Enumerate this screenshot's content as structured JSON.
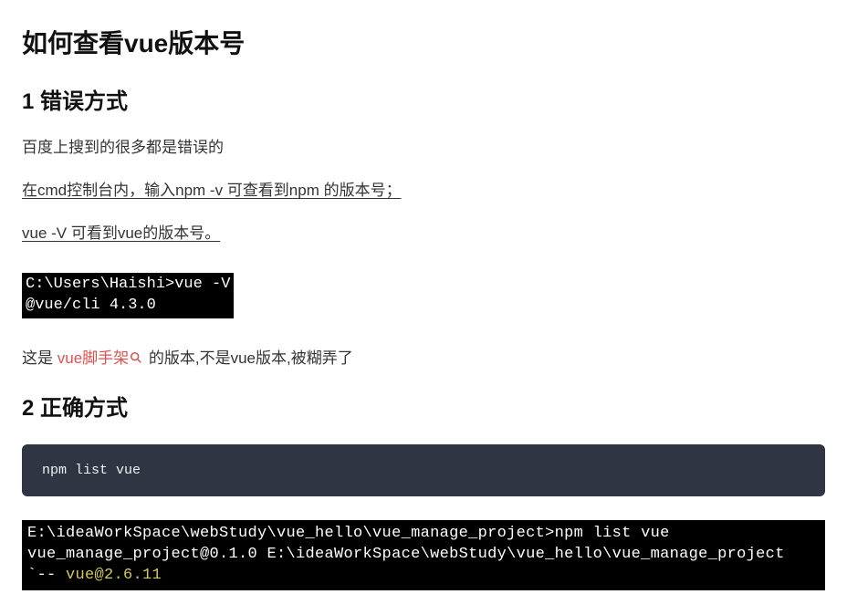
{
  "title": "如何查看vue版本号",
  "section1": {
    "heading": "1 错误方式",
    "p1": "百度上搜到的很多都是错误的",
    "p2": "在cmd控制台内，输入npm -v 可查看到npm 的版本号；",
    "p3": "vue -V 可看到vue的版本号。",
    "terminal": "C:\\Users\\Haishi>vue -V\n@vue/cli 4.3.0",
    "explain_prefix": "这是 ",
    "explain_highlight": "vue脚手架",
    "explain_suffix": " 的版本,不是vue版本,被糊弄了"
  },
  "section2": {
    "heading": "2 正确方式",
    "code": "npm list vue",
    "terminal_line1": "E:\\ideaWorkSpace\\webStudy\\vue_hello\\vue_manage_project>npm list vue",
    "terminal_line2": "vue_manage_project@0.1.0 E:\\ideaWorkSpace\\webStudy\\vue_hello\\vue_manage_project",
    "terminal_tree": "`-- ",
    "terminal_version": "vue@2.6.11"
  }
}
